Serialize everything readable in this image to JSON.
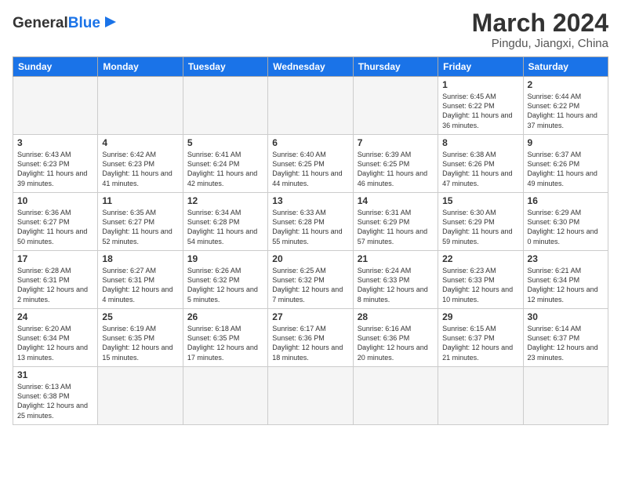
{
  "header": {
    "logo_general": "General",
    "logo_blue": "Blue",
    "title": "March 2024",
    "subtitle": "Pingdu, Jiangxi, China"
  },
  "days_of_week": [
    "Sunday",
    "Monday",
    "Tuesday",
    "Wednesday",
    "Thursday",
    "Friday",
    "Saturday"
  ],
  "weeks": [
    [
      {
        "day": "",
        "info": "",
        "empty": true
      },
      {
        "day": "",
        "info": "",
        "empty": true
      },
      {
        "day": "",
        "info": "",
        "empty": true
      },
      {
        "day": "",
        "info": "",
        "empty": true
      },
      {
        "day": "",
        "info": "",
        "empty": true
      },
      {
        "day": "1",
        "info": "Sunrise: 6:45 AM\nSunset: 6:22 PM\nDaylight: 11 hours and 36 minutes."
      },
      {
        "day": "2",
        "info": "Sunrise: 6:44 AM\nSunset: 6:22 PM\nDaylight: 11 hours and 37 minutes."
      }
    ],
    [
      {
        "day": "3",
        "info": "Sunrise: 6:43 AM\nSunset: 6:23 PM\nDaylight: 11 hours and 39 minutes."
      },
      {
        "day": "4",
        "info": "Sunrise: 6:42 AM\nSunset: 6:23 PM\nDaylight: 11 hours and 41 minutes."
      },
      {
        "day": "5",
        "info": "Sunrise: 6:41 AM\nSunset: 6:24 PM\nDaylight: 11 hours and 42 minutes."
      },
      {
        "day": "6",
        "info": "Sunrise: 6:40 AM\nSunset: 6:25 PM\nDaylight: 11 hours and 44 minutes."
      },
      {
        "day": "7",
        "info": "Sunrise: 6:39 AM\nSunset: 6:25 PM\nDaylight: 11 hours and 46 minutes."
      },
      {
        "day": "8",
        "info": "Sunrise: 6:38 AM\nSunset: 6:26 PM\nDaylight: 11 hours and 47 minutes."
      },
      {
        "day": "9",
        "info": "Sunrise: 6:37 AM\nSunset: 6:26 PM\nDaylight: 11 hours and 49 minutes."
      }
    ],
    [
      {
        "day": "10",
        "info": "Sunrise: 6:36 AM\nSunset: 6:27 PM\nDaylight: 11 hours and 50 minutes."
      },
      {
        "day": "11",
        "info": "Sunrise: 6:35 AM\nSunset: 6:27 PM\nDaylight: 11 hours and 52 minutes."
      },
      {
        "day": "12",
        "info": "Sunrise: 6:34 AM\nSunset: 6:28 PM\nDaylight: 11 hours and 54 minutes."
      },
      {
        "day": "13",
        "info": "Sunrise: 6:33 AM\nSunset: 6:28 PM\nDaylight: 11 hours and 55 minutes."
      },
      {
        "day": "14",
        "info": "Sunrise: 6:31 AM\nSunset: 6:29 PM\nDaylight: 11 hours and 57 minutes."
      },
      {
        "day": "15",
        "info": "Sunrise: 6:30 AM\nSunset: 6:29 PM\nDaylight: 11 hours and 59 minutes."
      },
      {
        "day": "16",
        "info": "Sunrise: 6:29 AM\nSunset: 6:30 PM\nDaylight: 12 hours and 0 minutes."
      }
    ],
    [
      {
        "day": "17",
        "info": "Sunrise: 6:28 AM\nSunset: 6:31 PM\nDaylight: 12 hours and 2 minutes."
      },
      {
        "day": "18",
        "info": "Sunrise: 6:27 AM\nSunset: 6:31 PM\nDaylight: 12 hours and 4 minutes."
      },
      {
        "day": "19",
        "info": "Sunrise: 6:26 AM\nSunset: 6:32 PM\nDaylight: 12 hours and 5 minutes."
      },
      {
        "day": "20",
        "info": "Sunrise: 6:25 AM\nSunset: 6:32 PM\nDaylight: 12 hours and 7 minutes."
      },
      {
        "day": "21",
        "info": "Sunrise: 6:24 AM\nSunset: 6:33 PM\nDaylight: 12 hours and 8 minutes."
      },
      {
        "day": "22",
        "info": "Sunrise: 6:23 AM\nSunset: 6:33 PM\nDaylight: 12 hours and 10 minutes."
      },
      {
        "day": "23",
        "info": "Sunrise: 6:21 AM\nSunset: 6:34 PM\nDaylight: 12 hours and 12 minutes."
      }
    ],
    [
      {
        "day": "24",
        "info": "Sunrise: 6:20 AM\nSunset: 6:34 PM\nDaylight: 12 hours and 13 minutes."
      },
      {
        "day": "25",
        "info": "Sunrise: 6:19 AM\nSunset: 6:35 PM\nDaylight: 12 hours and 15 minutes."
      },
      {
        "day": "26",
        "info": "Sunrise: 6:18 AM\nSunset: 6:35 PM\nDaylight: 12 hours and 17 minutes."
      },
      {
        "day": "27",
        "info": "Sunrise: 6:17 AM\nSunset: 6:36 PM\nDaylight: 12 hours and 18 minutes."
      },
      {
        "day": "28",
        "info": "Sunrise: 6:16 AM\nSunset: 6:36 PM\nDaylight: 12 hours and 20 minutes."
      },
      {
        "day": "29",
        "info": "Sunrise: 6:15 AM\nSunset: 6:37 PM\nDaylight: 12 hours and 21 minutes."
      },
      {
        "day": "30",
        "info": "Sunrise: 6:14 AM\nSunset: 6:37 PM\nDaylight: 12 hours and 23 minutes."
      }
    ],
    [
      {
        "day": "31",
        "info": "Sunrise: 6:13 AM\nSunset: 6:38 PM\nDaylight: 12 hours and 25 minutes."
      },
      {
        "day": "",
        "info": "",
        "empty": true
      },
      {
        "day": "",
        "info": "",
        "empty": true
      },
      {
        "day": "",
        "info": "",
        "empty": true
      },
      {
        "day": "",
        "info": "",
        "empty": true
      },
      {
        "day": "",
        "info": "",
        "empty": true
      },
      {
        "day": "",
        "info": "",
        "empty": true
      }
    ]
  ]
}
